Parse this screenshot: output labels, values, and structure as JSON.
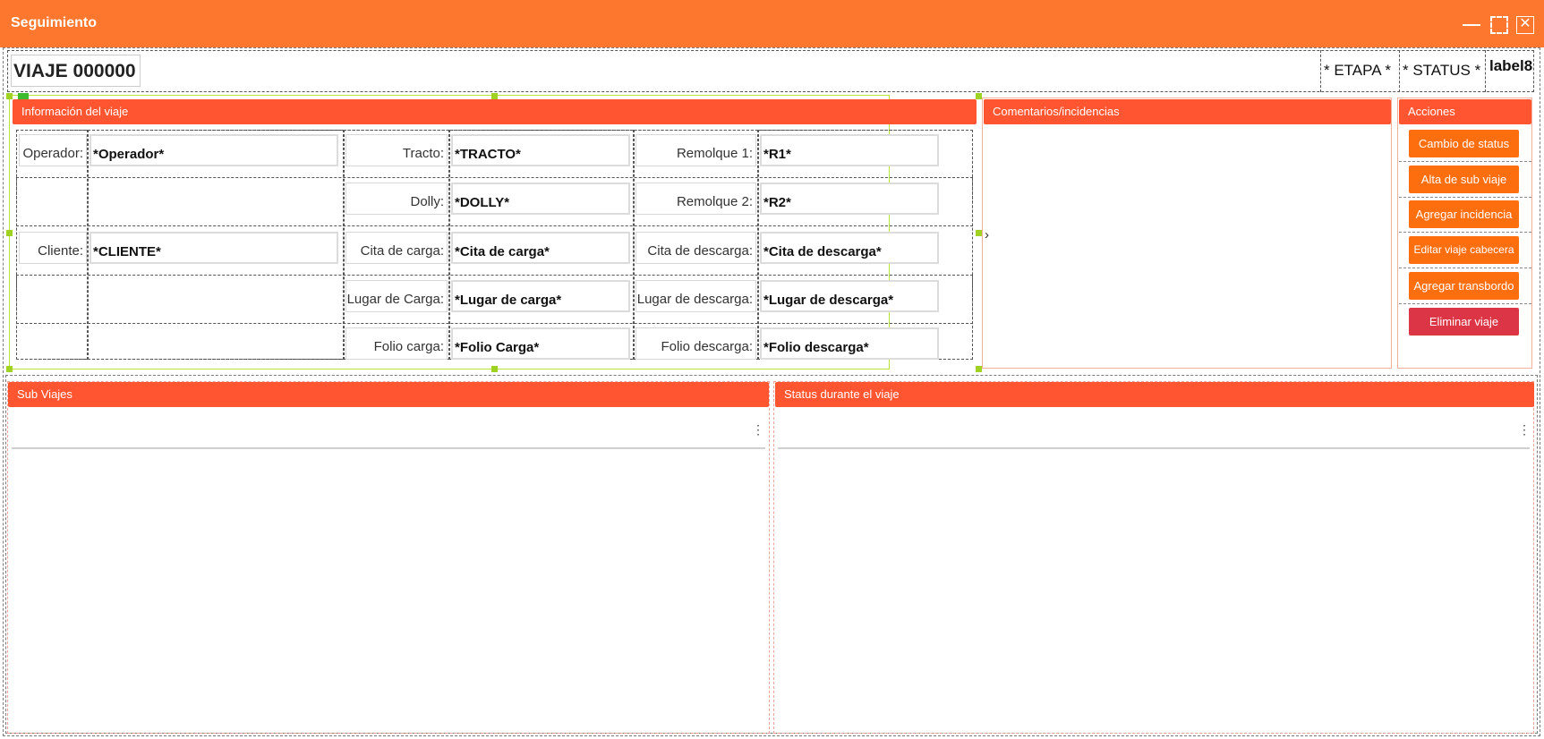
{
  "window": {
    "title": "Seguimiento"
  },
  "header": {
    "viaje": "VIAJE 000000",
    "etapa": "* ETAPA *",
    "status": "* STATUS *",
    "label8": "label8"
  },
  "info_panel": {
    "title": "Información del viaje",
    "fields": {
      "operador": {
        "label": "Operador:",
        "value": "*Operador*"
      },
      "tracto": {
        "label": "Tracto:",
        "value": "*TRACTO*"
      },
      "remolque1": {
        "label": "Remolque 1:",
        "value": "*R1*"
      },
      "dolly": {
        "label": "Dolly:",
        "value": "*DOLLY*"
      },
      "remolque2": {
        "label": "Remolque 2:",
        "value": "*R2*"
      },
      "cliente": {
        "label": "Cliente:",
        "value": "*CLIENTE*"
      },
      "cita_carga": {
        "label": "Cita de carga:",
        "value": "*Cita de carga*"
      },
      "cita_descarga": {
        "label": "Cita de descarga:",
        "value": "*Cita de descarga*"
      },
      "lugar_carga": {
        "label": "Lugar de Carga:",
        "value": "*Lugar de carga*"
      },
      "lugar_descarga": {
        "label": "Lugar de descarga:",
        "value": "*Lugar de descarga*"
      },
      "folio_carga": {
        "label": "Folio carga:",
        "value": "*Folio Carga*"
      },
      "folio_descarga": {
        "label": "Folio descarga:",
        "value": "*Folio descarga*"
      }
    }
  },
  "comments_panel": {
    "title": "Comentarios/incidencias"
  },
  "actions_panel": {
    "title": "Acciones",
    "buttons": [
      "Cambio de status",
      "Alta de sub viaje",
      "Agregar incidencia",
      "Editar viaje cabecera",
      "Agregar transbordo",
      "Eliminar viaje"
    ]
  },
  "sub_viajes": {
    "title": "Sub Viajes"
  },
  "status_viaje": {
    "title": "Status durante el viaje"
  },
  "icons": {
    "kebab": "⋮",
    "chevron": "›",
    "close": "✕"
  },
  "colors": {
    "titlebar": "#FD772E",
    "panel_header": "#FF5530",
    "action_button": "#FD6E0E",
    "danger_button": "#DC3545"
  }
}
